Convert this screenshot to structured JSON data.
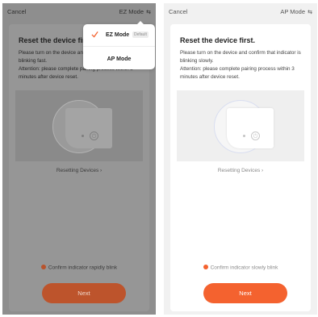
{
  "screens": [
    {
      "cancel_label": "Cancel",
      "mode_label": "EZ Mode",
      "mode_icon": "swap-icon",
      "title": "Reset the device first.",
      "desc_line1": "Please turn on the device and",
      "desc_line2": "blinking fast.",
      "desc_line3": "Attention: please complete pairing process within 3",
      "desc_line4": "minutes after device reset.",
      "resetting_label": "Resetting Devices",
      "confirm_label": "Confirm indicator rapidly blink",
      "next_label": "Next",
      "dimmed": true
    },
    {
      "cancel_label": "Cancel",
      "mode_label": "AP Mode",
      "mode_icon": "swap-icon",
      "title": "Reset the device first.",
      "desc_line1": "Please turn on the device and confirm that indicator is",
      "desc_line2": "blinking slowly.",
      "desc_line3": "Attention: please complete pairing process within 3",
      "desc_line4": "minutes after device reset.",
      "resetting_label": "Resetting Devices",
      "confirm_label": "Confirm indicator slowly blink",
      "next_label": "Next",
      "dimmed": false
    }
  ],
  "mode_menu": {
    "items": [
      {
        "label": "EZ Mode",
        "badge": "Default",
        "selected": true
      },
      {
        "label": "AP Mode",
        "selected": false
      }
    ]
  },
  "colors": {
    "accent": "#f4622f",
    "dimmed_accent": "#bd542c",
    "overlay_bg": "#8e8e8e",
    "page_bg": "#f1f1f1"
  }
}
